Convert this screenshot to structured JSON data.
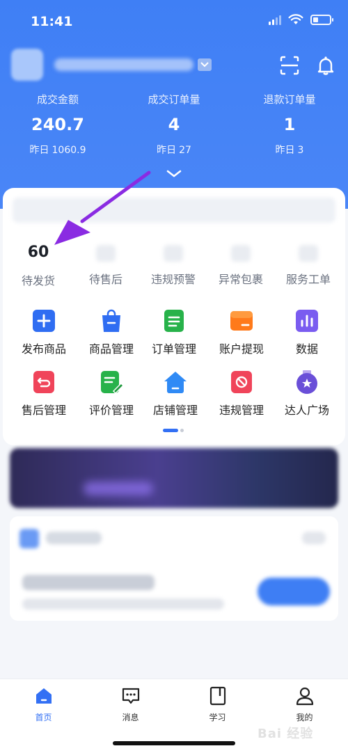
{
  "status_bar": {
    "time": "11:41"
  },
  "stats": [
    {
      "label": "成交金额",
      "value": "240.7",
      "yesterday_label": "昨日",
      "yesterday_value": "1060.9"
    },
    {
      "label": "成交订单量",
      "value": "4",
      "yesterday_label": "昨日",
      "yesterday_value": "27"
    },
    {
      "label": "退款订单量",
      "value": "1",
      "yesterday_label": "昨日",
      "yesterday_value": "3"
    }
  ],
  "metrics": [
    {
      "label": "待发货",
      "value": "60"
    },
    {
      "label": "待售后",
      "value": ""
    },
    {
      "label": "违规预警",
      "value": ""
    },
    {
      "label": "异常包裹",
      "value": ""
    },
    {
      "label": "服务工单",
      "value": ""
    }
  ],
  "tools": [
    {
      "label": "发布商品",
      "icon": "add-icon",
      "color": "#2f6df2"
    },
    {
      "label": "商品管理",
      "icon": "shopping-bag-icon",
      "color": "#2f6df2"
    },
    {
      "label": "订单管理",
      "icon": "order-list-icon",
      "color": "#27b24a"
    },
    {
      "label": "账户提现",
      "icon": "wallet-icon",
      "color": "#ff7a1a"
    },
    {
      "label": "数据",
      "icon": "bar-chart-icon",
      "color": "#7a5cf0"
    },
    {
      "label": "售后管理",
      "icon": "return-icon",
      "color": "#f0445a"
    },
    {
      "label": "评价管理",
      "icon": "review-edit-icon",
      "color": "#27b24a"
    },
    {
      "label": "店铺管理",
      "icon": "store-icon",
      "color": "#2f8af5"
    },
    {
      "label": "违规管理",
      "icon": "prohibited-icon",
      "color": "#f0445a"
    },
    {
      "label": "达人广场",
      "icon": "star-medal-icon",
      "color": "#6a4fd8"
    }
  ],
  "tabbar": [
    {
      "label": "首页",
      "icon": "home-icon",
      "active": true
    },
    {
      "label": "消息",
      "icon": "message-icon",
      "active": false
    },
    {
      "label": "学习",
      "icon": "book-icon",
      "active": false
    },
    {
      "label": "我的",
      "icon": "profile-icon",
      "active": false
    }
  ],
  "watermark": "Bai 经验",
  "colors": {
    "header_blue": "#4283f6",
    "accent_purple": "#8a2be2",
    "active_tab": "#3370f4"
  }
}
